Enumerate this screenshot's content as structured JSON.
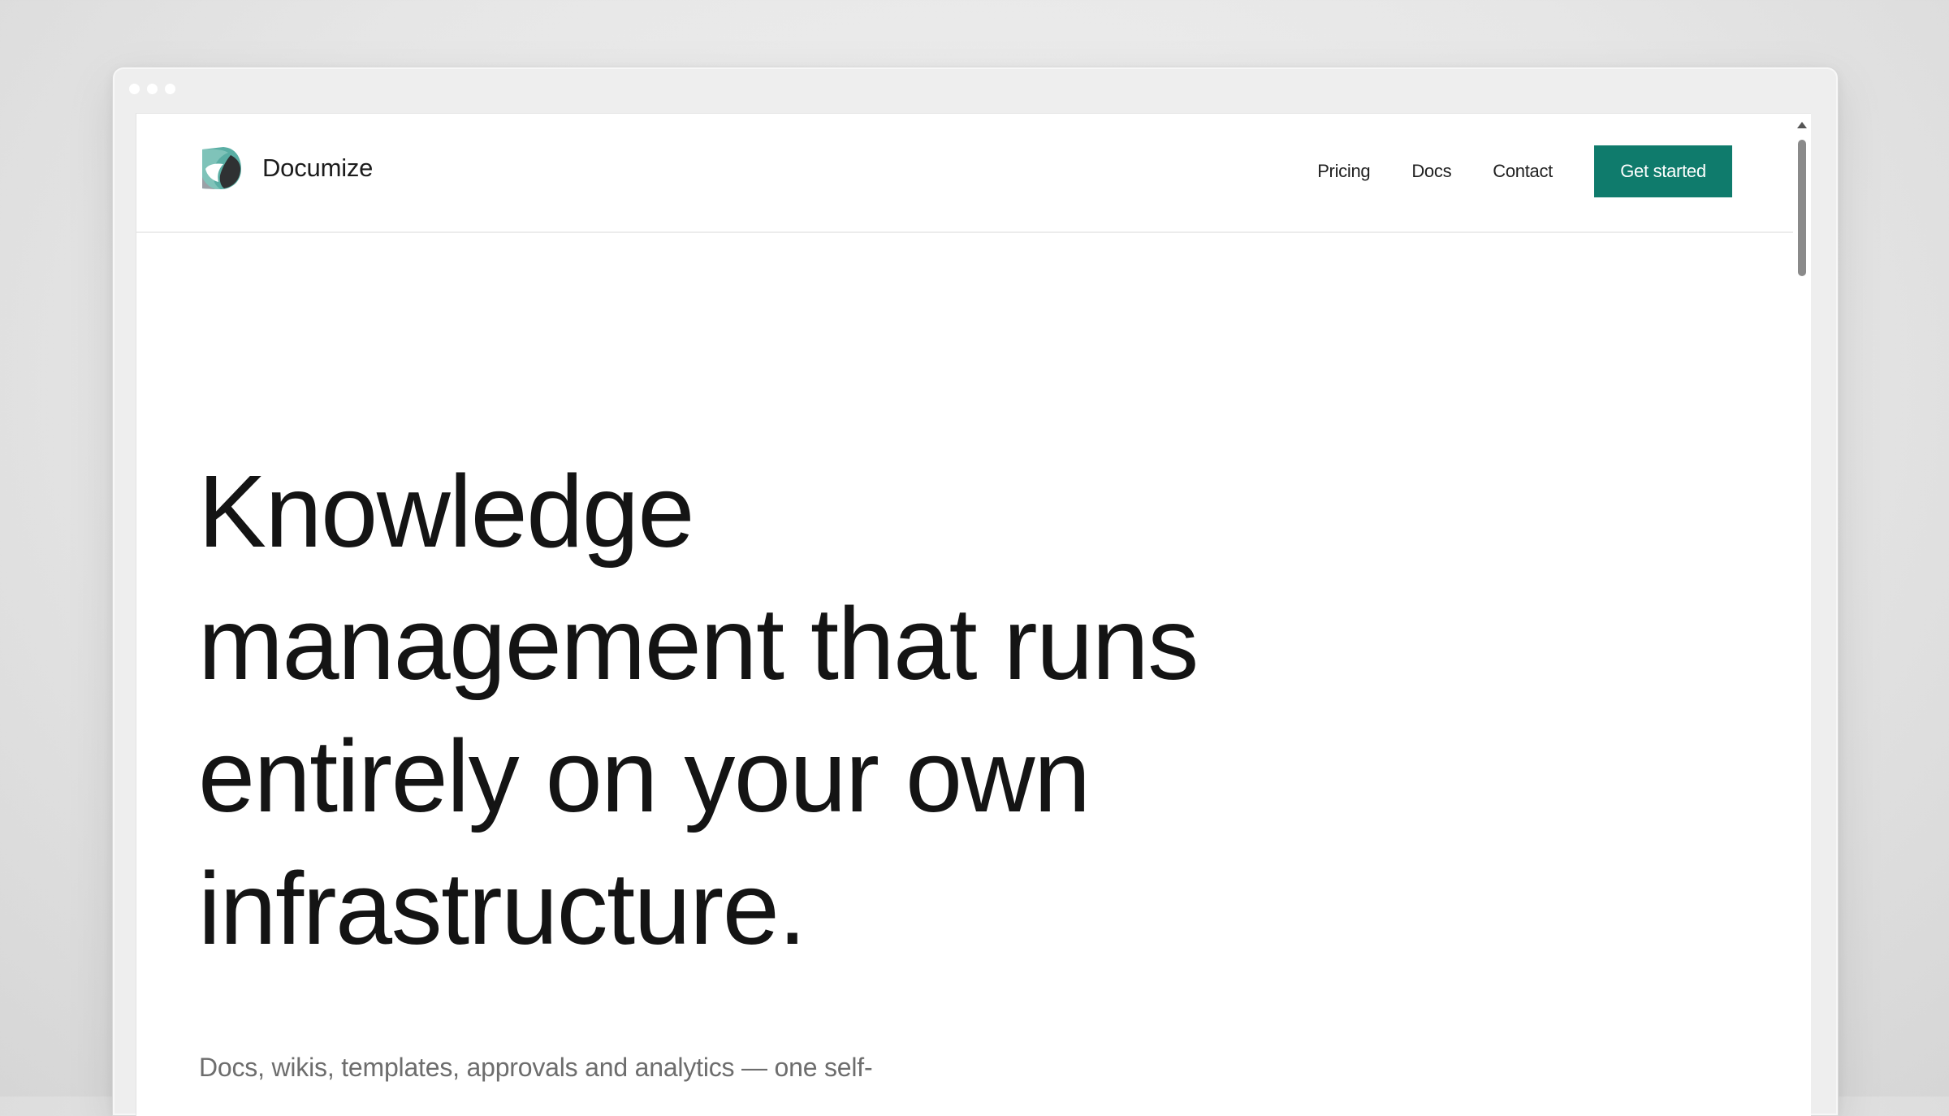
{
  "window": {
    "controls": [
      "dot",
      "dot",
      "dot"
    ]
  },
  "header": {
    "brand_name": "Documize",
    "logo_icon": "documize-logo-icon",
    "nav": [
      {
        "label": "Pricing"
      },
      {
        "label": "Docs"
      },
      {
        "label": "Contact"
      }
    ],
    "cta_label": "Get started"
  },
  "hero": {
    "title_lines": [
      "Knowledge",
      "management that runs",
      "entirely on your own",
      "infrastructure."
    ],
    "subtitle": "Docs, wikis, templates, approvals and analytics — one self-"
  },
  "colors": {
    "accent": "#0f7b6c",
    "logo_teal": "#5aaea4",
    "logo_grey": "#9aa0a6",
    "text": "#141414",
    "muted_text": "#6d6d6d",
    "background": "#ffffff"
  }
}
